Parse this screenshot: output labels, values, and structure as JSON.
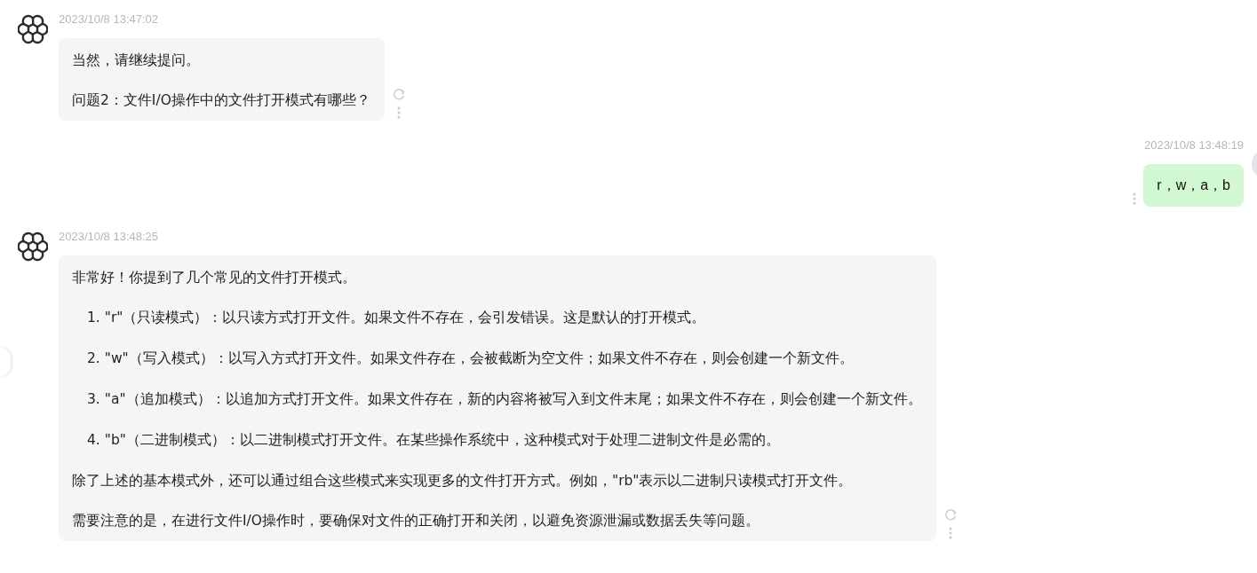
{
  "messages": [
    {
      "kind": "assistant",
      "time": "2023/10/8 13:47:02",
      "blocks": [
        {
          "kind": "paragraph",
          "text": "当然，请继续提问。"
        },
        {
          "kind": "paragraph",
          "text": "问题2：文件I/O操作中的文件打开模式有哪些？"
        }
      ]
    },
    {
      "kind": "user",
      "time": "2023/10/8 13:48:19",
      "blocks": [
        {
          "kind": "paragraph",
          "text": "r，w，a，b"
        }
      ]
    },
    {
      "kind": "assistant",
      "time": "2023/10/8 13:48:25",
      "blocks": [
        {
          "kind": "paragraph",
          "text": "非常好！你提到了几个常见的文件打开模式。"
        },
        {
          "kind": "list",
          "items": [
            {
              "number": "1.",
              "text": "\"r\"（只读模式）：以只读方式打开文件。如果文件不存在，会引发错误。这是默认的打开模式。"
            },
            {
              "number": "2.",
              "text": "\"w\"（写入模式）：以写入方式打开文件。如果文件存在，会被截断为空文件；如果文件不存在，则会创建一个新文件。"
            },
            {
              "number": "3.",
              "text": "\"a\"（追加模式）：以追加方式打开文件。如果文件存在，新的内容将被写入到文件末尾；如果文件不存在，则会创建一个新文件。"
            },
            {
              "number": "4.",
              "text": "\"b\"（二进制模式）：以二进制模式打开文件。在某些操作系统中，这种模式对于处理二进制文件是必需的。"
            }
          ]
        },
        {
          "kind": "paragraph",
          "text": "除了上述的基本模式外，还可以通过组合这些模式来实现更多的文件打开方式。例如，\"rb\"表示以二进制只读模式打开文件。"
        },
        {
          "kind": "paragraph",
          "text": "需要注意的是，在进行文件I/O操作时，要确保对文件的正确打开和关闭，以避免资源泄漏或数据丢失等问题。"
        }
      ]
    }
  ]
}
